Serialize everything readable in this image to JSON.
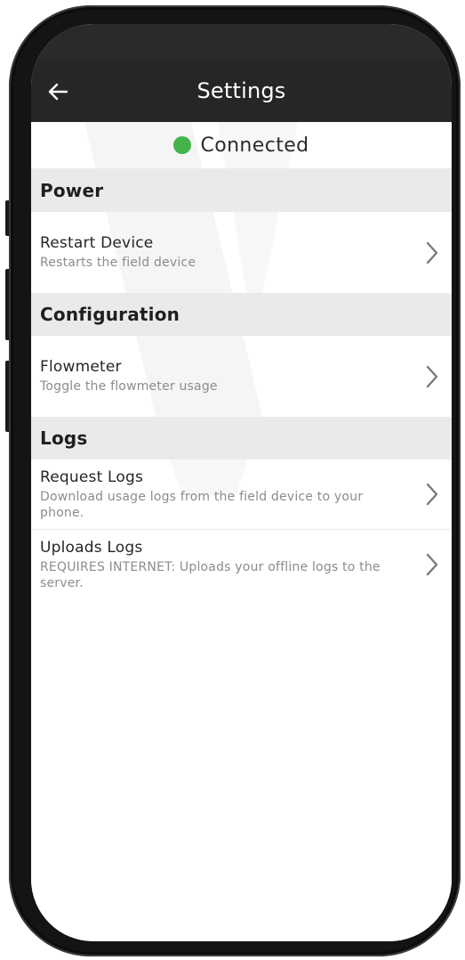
{
  "header": {
    "title": "Settings",
    "back_icon": "arrow-left-icon"
  },
  "connection": {
    "status_label": "Connected",
    "status_color": "#43b34a"
  },
  "sections": [
    {
      "title": "Power",
      "items": [
        {
          "title": "Restart Device",
          "subtitle": "Restarts the field device"
        }
      ]
    },
    {
      "title": "Configuration",
      "items": [
        {
          "title": "Flowmeter",
          "subtitle": "Toggle the flowmeter usage"
        }
      ]
    },
    {
      "title": "Logs",
      "items": [
        {
          "title": "Request Logs",
          "subtitle": "Download usage logs from the field device to your phone."
        },
        {
          "title": "Uploads Logs",
          "subtitle": "REQUIRES INTERNET: Uploads your offline logs to the server."
        }
      ]
    }
  ],
  "colors": {
    "header_bg": "#262626",
    "section_bg": "#e8e8e8",
    "accent_connected": "#43b34a"
  }
}
